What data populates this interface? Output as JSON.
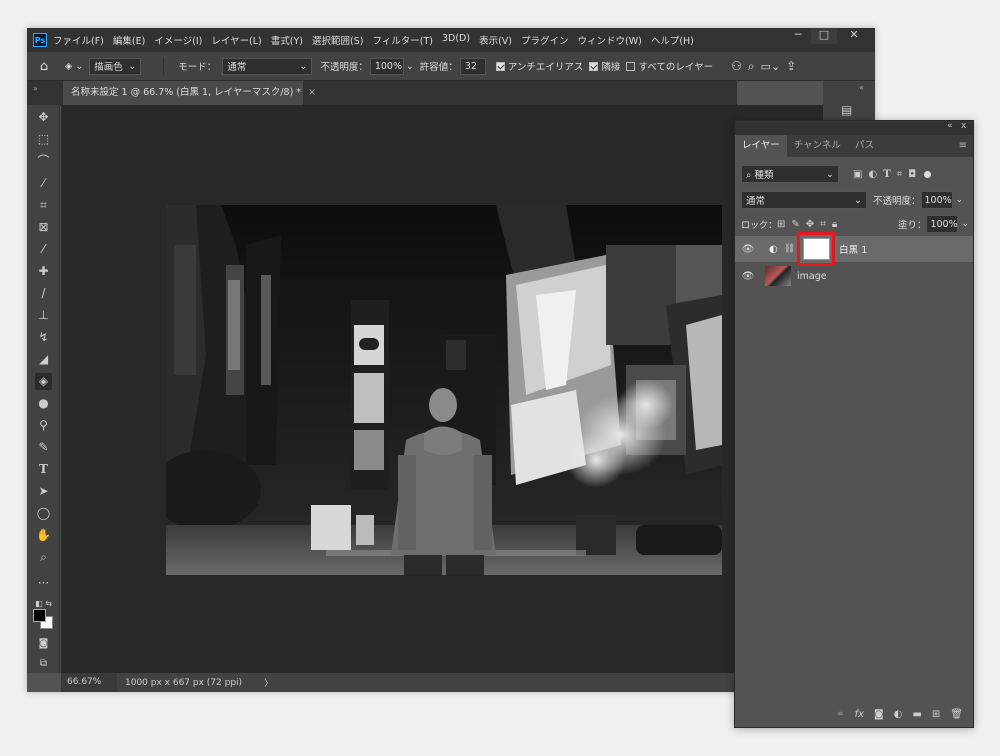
{
  "menubar": {
    "logo": "Ps",
    "items": [
      "ファイル(F)",
      "編集(E)",
      "イメージ(I)",
      "レイヤー(L)",
      "書式(Y)",
      "選択範囲(S)",
      "フィルター(T)",
      "3D(D)",
      "表示(V)",
      "プラグイン",
      "ウィンドウ(W)",
      "ヘルプ(H)"
    ],
    "minimize": "─",
    "maximize": "□",
    "close": "✕"
  },
  "options": {
    "fill_source": "描画色",
    "mode_label": "モード：",
    "mode_value": "通常",
    "opacity_label": "不透明度：",
    "opacity_value": "100%",
    "tolerance_label": "許容値：",
    "tolerance_value": "32",
    "antialias_label": "アンチエイリアス",
    "contiguous_label": "隣接",
    "all_layers_label": "すべてのレイヤー"
  },
  "document": {
    "tab_title": "名称未設定 1 @ 66.7% (白黒 1, レイヤーマスク/8) *",
    "tab_close": "×"
  },
  "status": {
    "zoom": "66.67%",
    "doc_info": "1000 px x 667 px (72 ppi)",
    "arrow": "〉"
  },
  "layers_panel": {
    "collapse": "«",
    "close": "x",
    "tabs": [
      "レイヤー",
      "チャンネル",
      "パス"
    ],
    "active_tab": 0,
    "filter_kind": "種類",
    "blend_mode": "通常",
    "opacity_label": "不透明度：",
    "opacity_value": "100%",
    "lock_label": "ロック：",
    "fill_label": "塗り：",
    "fill_value": "100%",
    "layers": [
      {
        "name": "白黒 1",
        "type": "adjustment",
        "mask_selected": true
      },
      {
        "name": "image",
        "type": "pixel"
      }
    ],
    "highlight_color": "#e8161c"
  }
}
